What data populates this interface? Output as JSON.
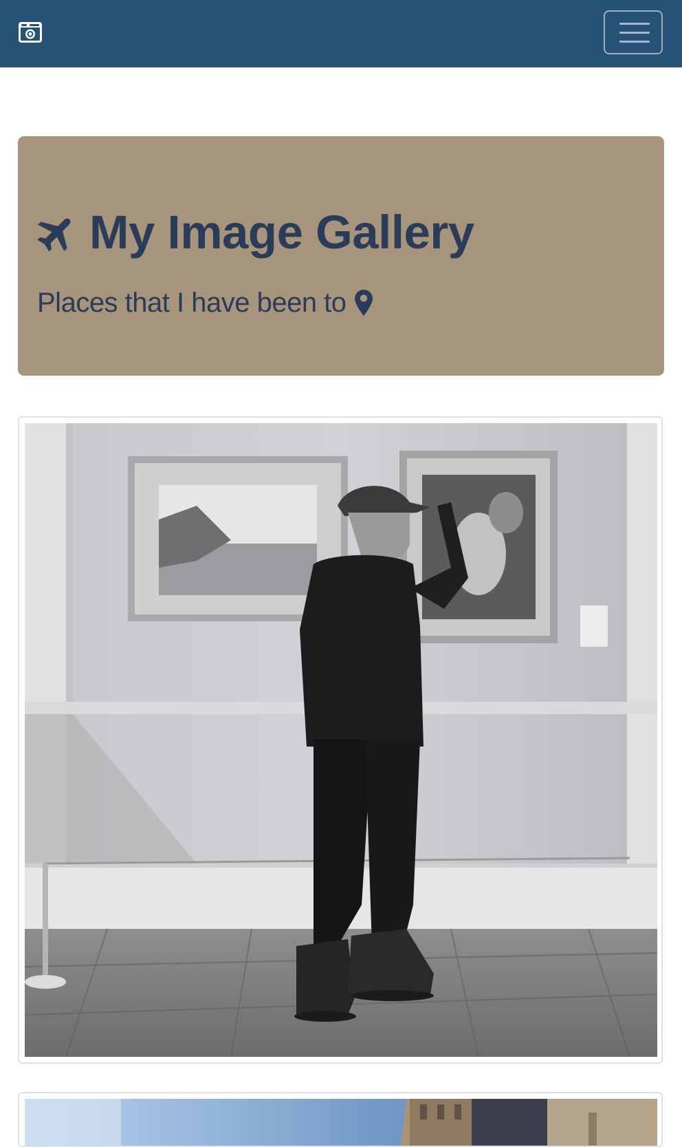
{
  "navbar": {
    "brand_icon": "camera-icon",
    "toggle_icon": "hamburger-menu-icon",
    "background": "#255275"
  },
  "jumbotron": {
    "title": "My Image Gallery",
    "title_icon": "plane-icon",
    "lead": "Places that I have been to",
    "lead_icon": "map-marker-icon",
    "background": "#a7947c",
    "text_color": "#2b3c58"
  },
  "gallery": {
    "images": [
      {
        "subject": "man-in-art-gallery-photo"
      },
      {
        "subject": "city-street-photo"
      }
    ]
  }
}
